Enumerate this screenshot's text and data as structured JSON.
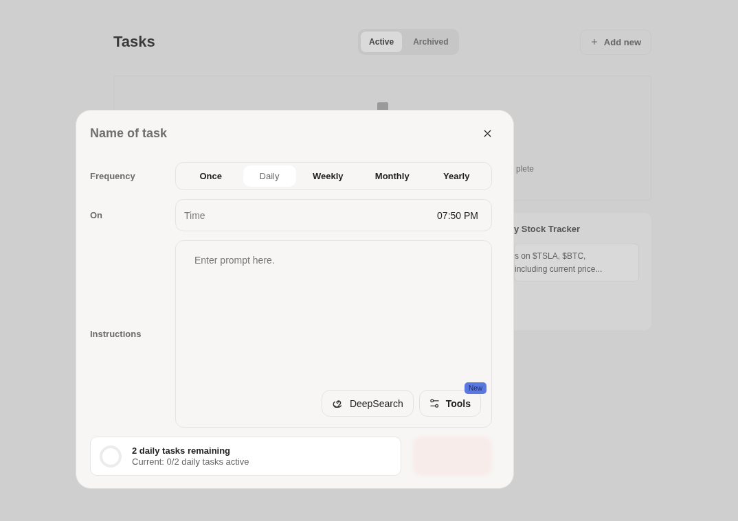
{
  "background": {
    "title": "Tasks",
    "tabs": [
      {
        "label": "Active",
        "selected": true
      },
      {
        "label": "Archived",
        "selected": false
      }
    ],
    "add_button": {
      "label": "Add new"
    },
    "empty_state": {
      "text": "plete"
    },
    "task_card": {
      "title": "y Stock Tracker",
      "description": [
        "s on $TSLA, $BTC,",
        "including current price..."
      ]
    }
  },
  "dialog": {
    "title": "Name of task",
    "frequency": {
      "label": "Frequency",
      "options": [
        {
          "label": "Once",
          "selected": false
        },
        {
          "label": "Daily",
          "selected": true
        },
        {
          "label": "Weekly",
          "selected": false
        },
        {
          "label": "Monthly",
          "selected": false
        },
        {
          "label": "Yearly",
          "selected": false
        }
      ]
    },
    "on": {
      "label": "On",
      "field_label": "Time",
      "value": "07:50 PM"
    },
    "instructions": {
      "label": "Instructions",
      "placeholder": "Enter prompt here."
    },
    "tools": [
      {
        "kind": "deepsearch",
        "label": "DeepSearch"
      },
      {
        "kind": "tools",
        "label": "Tools",
        "badge": "New"
      }
    ],
    "quota": {
      "title": "2 daily tasks remaining",
      "detail": "Current: 0/2 daily tasks active",
      "level": 0
    }
  }
}
